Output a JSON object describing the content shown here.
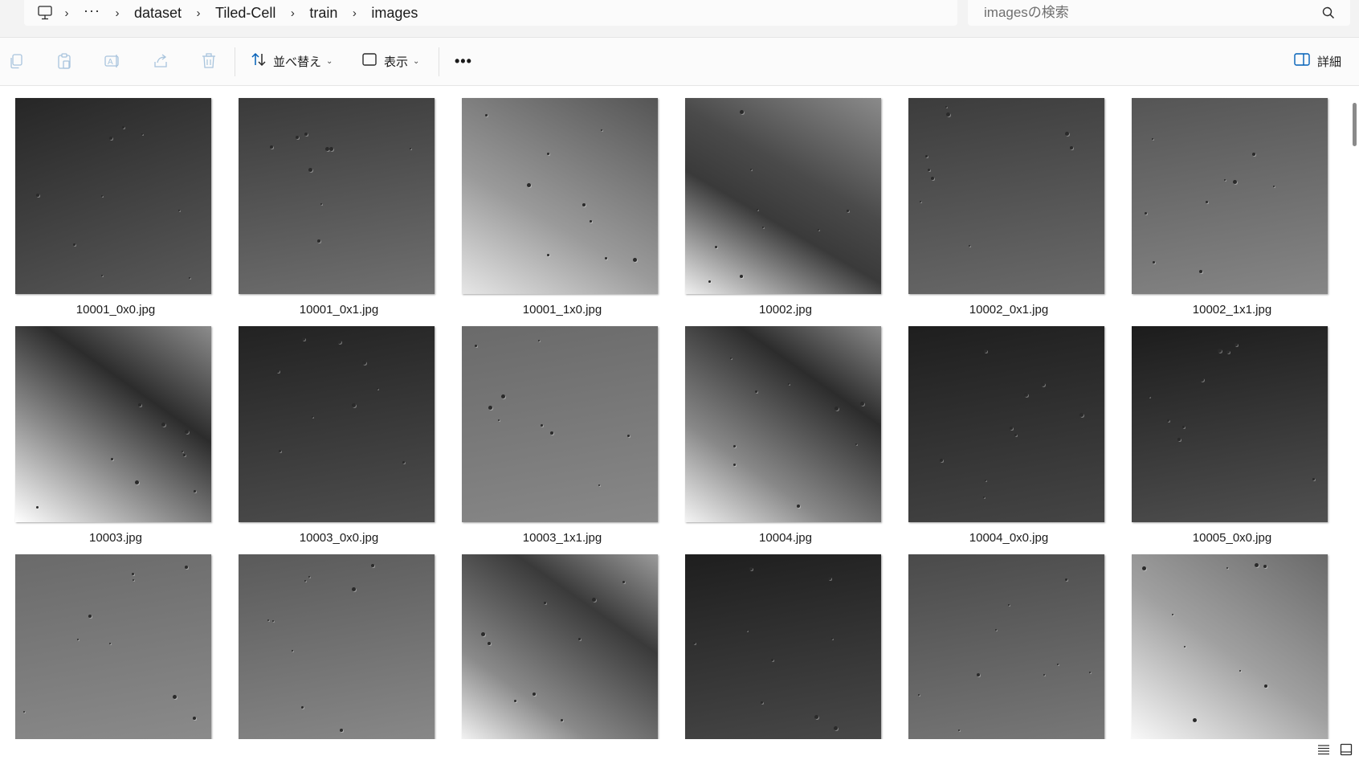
{
  "breadcrumb": {
    "root_icon": "pc-icon",
    "more": "···",
    "items": [
      "dataset",
      "Tiled-Cell",
      "train",
      "images"
    ],
    "separator": "›"
  },
  "search": {
    "placeholder": "imagesの検索",
    "value": ""
  },
  "toolbar": {
    "sort_label": "並べ替え",
    "view_label": "表示",
    "more_label": "•••",
    "details_label": "詳細",
    "disabled_icons": [
      "copy-icon",
      "paste-icon",
      "rename-icon",
      "share-icon",
      "delete-icon"
    ]
  },
  "files": [
    {
      "name": "10001_0x0.jpg"
    },
    {
      "name": "10001_0x1.jpg"
    },
    {
      "name": "10001_1x0.jpg"
    },
    {
      "name": "10002.jpg"
    },
    {
      "name": "10002_0x1.jpg"
    },
    {
      "name": "10002_1x1.jpg"
    },
    {
      "name": "10003.jpg"
    },
    {
      "name": "10003_0x0.jpg"
    },
    {
      "name": "10003_1x1.jpg"
    },
    {
      "name": "10004.jpg"
    },
    {
      "name": "10004_0x0.jpg"
    },
    {
      "name": "10005_0x0.jpg"
    },
    {
      "name": ""
    },
    {
      "name": ""
    },
    {
      "name": ""
    },
    {
      "name": ""
    },
    {
      "name": ""
    },
    {
      "name": ""
    }
  ],
  "status": {
    "view_icons": [
      "details-view-icon",
      "large-icons-view-icon"
    ]
  },
  "colors": {
    "addr_bg": "#f3f3f3",
    "accent": "#005fb8",
    "disabled_icon": "#a8c4dd"
  }
}
